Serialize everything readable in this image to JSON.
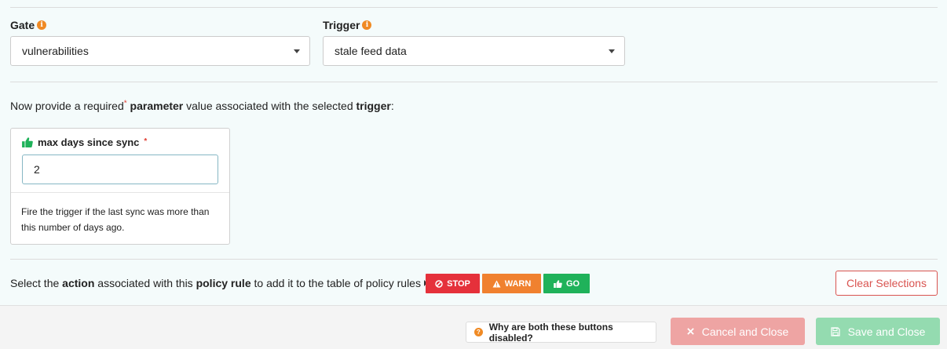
{
  "gate": {
    "label": "Gate",
    "value": "vulnerabilities"
  },
  "trigger": {
    "label": "Trigger",
    "value": "stale feed data"
  },
  "prompt": {
    "prefix": "Now provide a required",
    "asterisk": "*",
    "param_word": "parameter",
    "middle": "value associated with the selected",
    "trigger_word": "trigger",
    "suffix": ":"
  },
  "parameter": {
    "name": "max days since sync",
    "asterisk": "*",
    "value": "2",
    "description": "Fire the trigger if the last sync was more than this number of days ago."
  },
  "action_row": {
    "prefix": "Select the",
    "action_word": "action",
    "middle": "associated with this",
    "rule_word": "policy rule",
    "suffix": "to add it to the table of policy rules"
  },
  "actions": {
    "stop": "STOP",
    "warn": "WARN",
    "go": "GO"
  },
  "clear_label": "Clear Selections",
  "footer": {
    "why_label": "Why are both these buttons disabled?",
    "cancel_label": "Cancel and Close",
    "save_label": "Save and Close"
  },
  "colors": {
    "stop": "#e5313b",
    "warn": "#f0812f",
    "go": "#1fb25a",
    "info": "#f08a24",
    "cancel_disabled": "#eea4a3",
    "save_disabled": "#94dbb0"
  },
  "icons": {
    "info": "info-icon",
    "thumbs_up": "thumbs-up-icon",
    "stop": "ban-icon",
    "warn": "warning-triangle-icon",
    "question": "question-icon",
    "cancel": "close-icon",
    "save": "floppy-disk-icon"
  }
}
